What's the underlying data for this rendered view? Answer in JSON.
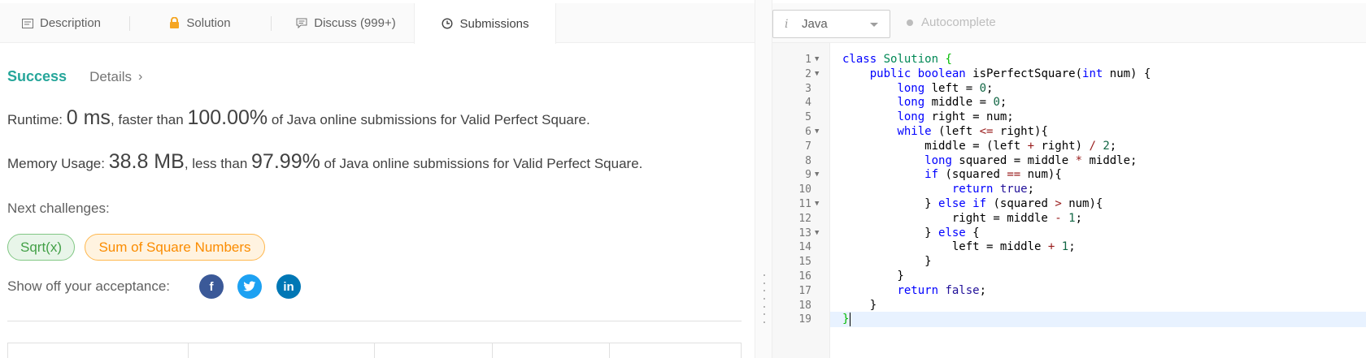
{
  "tabs": [
    {
      "label": "Description",
      "icon": "description-icon"
    },
    {
      "label": "Solution",
      "icon": "lock-icon"
    },
    {
      "label": "Discuss (999+)",
      "icon": "discuss-icon"
    },
    {
      "label": "Submissions",
      "icon": "clock-icon"
    }
  ],
  "result": {
    "status": "Success",
    "details_label": "Details",
    "runtime": {
      "prefix": "Runtime: ",
      "value": "0 ms",
      "mid": ", faster than ",
      "percent": "100.00%",
      "suffix": " of Java online submissions for Valid Perfect Square."
    },
    "memory": {
      "prefix": "Memory Usage: ",
      "value": "38.8 MB",
      "mid": ", less than ",
      "percent": "97.99%",
      "suffix": " of Java online submissions for Valid Perfect Square."
    },
    "next_challenges_label": "Next challenges:",
    "next_challenges": [
      "Sqrt(x)",
      "Sum of Square Numbers"
    ],
    "share_label": "Show off your acceptance:",
    "share": [
      {
        "name": "facebook",
        "glyph": "f"
      },
      {
        "name": "twitter",
        "glyph": "t"
      },
      {
        "name": "linkedin",
        "glyph": "in"
      }
    ]
  },
  "editor": {
    "language_info": "i",
    "language": "Java",
    "autocomplete_label": "Autocomplete",
    "line_numbers": [
      "1",
      "2",
      "3",
      "4",
      "5",
      "6",
      "7",
      "8",
      "9",
      "10",
      "11",
      "12",
      "13",
      "14",
      "15",
      "16",
      "17",
      "18",
      "19"
    ],
    "fold_lines": [
      1,
      2,
      6,
      9,
      11,
      13
    ],
    "active_line": 19,
    "code": [
      "class Solution {",
      "    public boolean isPerfectSquare(int num) {",
      "        long left = 0;",
      "        long middle = 0;",
      "        long right = num;",
      "        while (left <= right){",
      "            middle = (left + right) / 2;",
      "            long squared = middle * middle;",
      "            if (squared == num){",
      "                return true;",
      "            } else if (squared > num){",
      "                right = middle - 1;",
      "            } else {",
      "                left = middle + 1;",
      "            }",
      "        }",
      "        return false;",
      "    }",
      "}"
    ]
  },
  "colors": {
    "success": "#26a69a",
    "pill_green": "#43a047",
    "pill_orange": "#fb8c00",
    "facebook": "#3b5998",
    "twitter": "#1da1f2",
    "linkedin": "#0077b5"
  }
}
